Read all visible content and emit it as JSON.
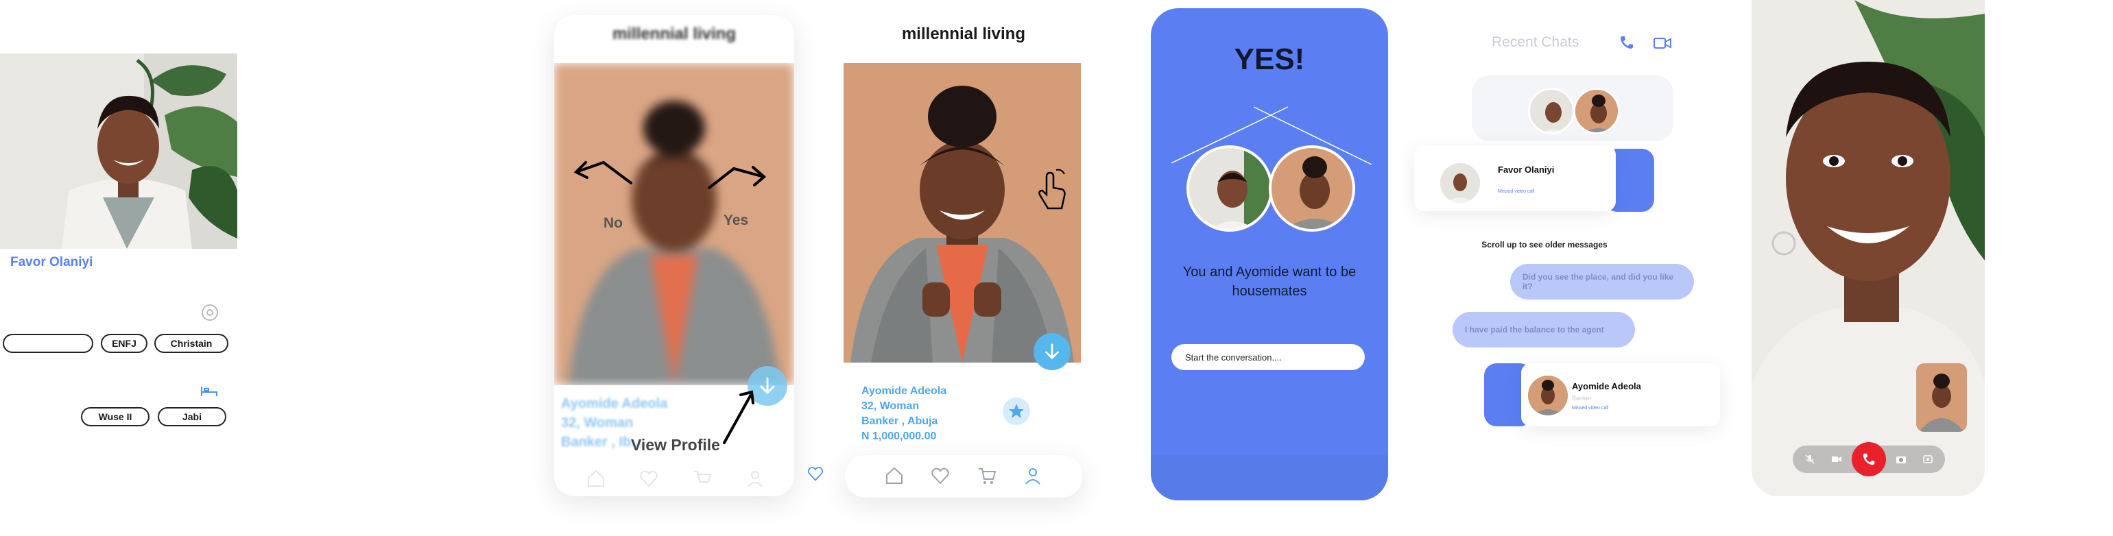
{
  "profile_panel": {
    "name": "Favor Olaniyi",
    "tags_row1": [
      "",
      "ENFJ",
      "Christain"
    ],
    "tags_row2": [
      "Wuse II",
      "Jabi"
    ]
  },
  "swipe_screen": {
    "app_title": "millennial living",
    "gesture_no": "No",
    "gesture_yes": "Yes",
    "name": "Ayomide Adeola",
    "detail_line1": "32, Woman",
    "detail_line2": "Banker , Ib...",
    "view_profile": "View Profile"
  },
  "profile_screen": {
    "app_title": "millennial living",
    "name": "Ayomide Adeola",
    "detail_line1": "32, Woman",
    "detail_line2": "Banker , Abuja",
    "price": "N 1,000,000.00"
  },
  "match_screen": {
    "headline": "YES!",
    "message": "You and Ayomide want to  be housemates",
    "input_placeholder": "Start the conversation...."
  },
  "chats_screen": {
    "title": "Recent Chats",
    "chat1_name": "Favor Olaniyi",
    "chat1_sub": "",
    "chat1_meta": "Missed video call",
    "scroll_hint": "Scroll up to see older messages",
    "bubble1": "Did you see the place, and did you like it?",
    "bubble2": "I have paid the balance to the agent",
    "chat2_name": "Ayomide Adeola",
    "chat2_sub": "Banker",
    "chat2_meta": "Missed video call"
  },
  "call_screen": {},
  "colors": {
    "accent_blue": "#5b7ff3",
    "light_blue": "#56b6ee",
    "end_call": "#e8212b"
  }
}
